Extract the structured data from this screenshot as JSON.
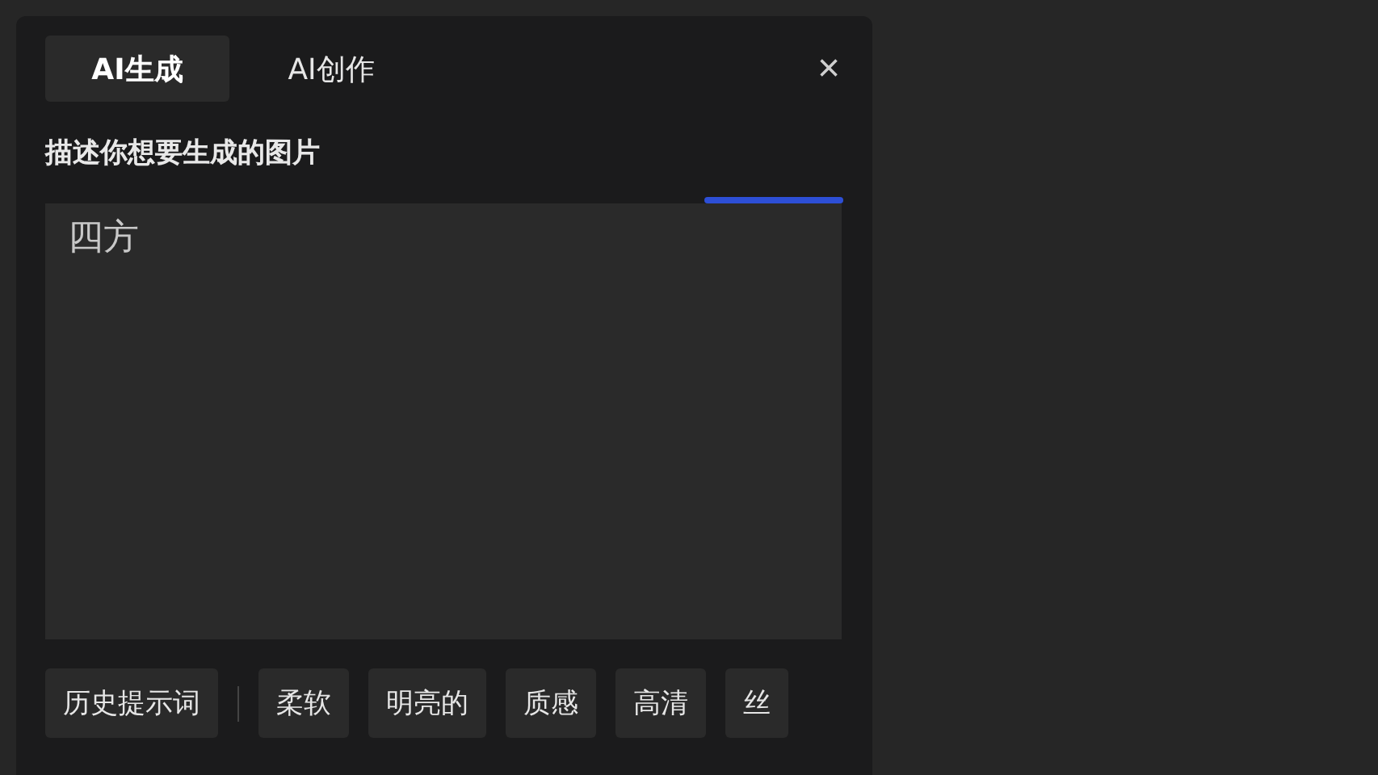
{
  "tabs": [
    {
      "label": "AI生成",
      "selected": true
    },
    {
      "label": "AI创作",
      "selected": false
    }
  ],
  "close": "×",
  "prompt_label": "描述你想要生成的图片",
  "prompt_field": {
    "value": "四方"
  },
  "history_button": "历史提示词",
  "suggestions": [
    {
      "label": "柔软"
    },
    {
      "label": "明亮的"
    },
    {
      "label": "质感"
    },
    {
      "label": "高清"
    },
    {
      "label": "丝"
    }
  ]
}
